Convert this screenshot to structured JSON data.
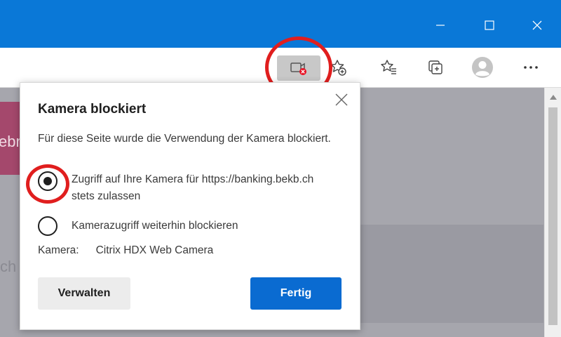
{
  "window": {
    "minimize_icon": "minimize-icon",
    "maximize_icon": "maximize-icon",
    "close_icon": "close-icon"
  },
  "toolbar": {
    "icons": [
      "camera-blocked-icon",
      "favorite-add-icon",
      "favorites-icon",
      "collections-icon",
      "profile-avatar-icon",
      "more-dots-icon"
    ]
  },
  "background": {
    "partial_text_top": "ebn",
    "partial_text_bottom": "ch"
  },
  "popup": {
    "title": "Kamera blockiert",
    "description": "Für diese Seite wurde die Verwendung der Kamera blockiert.",
    "options": [
      {
        "label": "Zugriff auf Ihre Kamera für https://banking.bekb.ch stets zulassen",
        "checked": true
      },
      {
        "label": "Kamerazugriff weiterhin blockieren",
        "checked": false
      }
    ],
    "camera_label": "Kamera:",
    "camera_value": "Citrix HDX Web Camera",
    "manage_button": "Verwalten",
    "done_button": "Fertig"
  },
  "colors": {
    "titlebar": "#0a78d7",
    "primary_button": "#0a6bd1",
    "callout": "#e01e1e",
    "blocked_badge": "#e81123"
  }
}
